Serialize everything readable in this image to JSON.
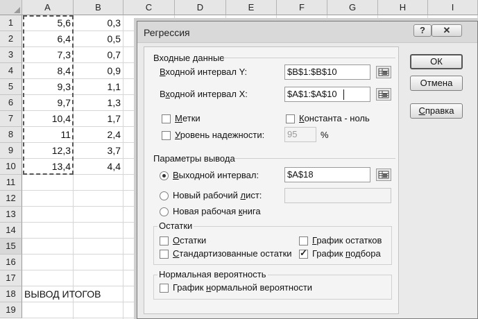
{
  "sheet": {
    "columns": [
      "A",
      "B",
      "C",
      "D",
      "E",
      "F",
      "G",
      "H",
      "I"
    ],
    "rows": [
      "1",
      "2",
      "3",
      "4",
      "5",
      "6",
      "7",
      "8",
      "9",
      "10",
      "11",
      "12",
      "13",
      "14",
      "15",
      "16",
      "17",
      "18",
      "19"
    ],
    "colA": [
      "5,6",
      "6,4",
      "7,3",
      "8,4",
      "9,3",
      "9,7",
      "10,4",
      "11",
      "12,3",
      "13,4"
    ],
    "colB": [
      "0,3",
      "0,5",
      "0,7",
      "0,9",
      "1,1",
      "1,3",
      "1,7",
      "2,4",
      "3,7",
      "4,4"
    ],
    "a18": "ВЫВОД ИТОГОВ"
  },
  "dialog": {
    "title": "Регрессия",
    "help_btn": "?",
    "close_btn": "✕",
    "input_section": "Входные данные",
    "y_range_label_u": "В",
    "y_range_label_rest": "ходной интервал Y:",
    "y_range_value": "$B$1:$B$10",
    "x_range_label_pre": "В",
    "x_range_label_u": "х",
    "x_range_label_rest": "одной интервал X:",
    "x_range_value": "$A$1:$A$10",
    "labels_u": "М",
    "labels_rest": "етки",
    "const_u": "К",
    "const_rest": "онстанта - ноль",
    "confidence_u": "У",
    "confidence_rest": "ровень надежности:",
    "confidence_value": "95",
    "percent": "%",
    "output_section": "Параметры вывода",
    "out_range_u": "В",
    "out_range_rest": "ыходной интервал:",
    "out_range_value": "$A$18",
    "new_sheet_pre": "Новый рабочий ",
    "new_sheet_u": "л",
    "new_sheet_rest": "ист:",
    "new_sheet_value": "",
    "new_book_pre": "Новая рабочая ",
    "new_book_u": "к",
    "new_book_rest": "нига",
    "residuals_section": "Остатки",
    "residuals_u": "О",
    "residuals_rest": "статки",
    "std_residuals_u": "С",
    "std_residuals_rest": "тандартизованные остатки",
    "resid_plot_u": "Г",
    "resid_plot_rest": "рафик остатков",
    "fit_plot_pre": "График ",
    "fit_plot_u": "п",
    "fit_plot_rest": "одбора",
    "normal_section": "Нормальная вероятность",
    "normal_plot_pre": "График ",
    "normal_plot_u": "н",
    "normal_plot_rest": "ормальной вероятности",
    "ok": "ОК",
    "cancel": "Отмена",
    "help_pre": "",
    "help_u": "С",
    "help_rest": "правка"
  },
  "state": {
    "labels_checked": false,
    "const_checked": false,
    "confidence_checked": false,
    "output_option": "out_range",
    "residuals_checked": false,
    "std_residuals_checked": false,
    "resid_plot_checked": false,
    "fit_plot_checked": true,
    "normal_plot_checked": false
  }
}
